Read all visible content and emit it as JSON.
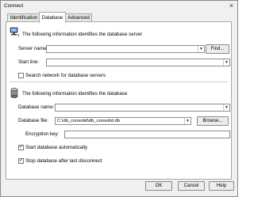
{
  "window": {
    "title": "Connect",
    "close_glyph": "×"
  },
  "tabs": [
    {
      "label": "Identification"
    },
    {
      "label": "Database"
    },
    {
      "label": "Advanced"
    }
  ],
  "server_section": {
    "heading": "The following information identifies the database server",
    "icon": "network-computer-icon",
    "server_name_label": "Server name:",
    "server_name_value": "",
    "find_button": "Find...",
    "start_line_label": "Start line:",
    "start_line_value": "",
    "search_network_label": "Search network for database servers",
    "search_network_checked": false
  },
  "database_section": {
    "heading": "The following information identifies the database",
    "icon": "database-cylinder-icon",
    "database_name_label": "Database name:",
    "database_name_value": "",
    "database_file_label": "Database file:",
    "database_file_value": "C:\\db_consolid\\db_consolid.db",
    "browse_button": "Browse...",
    "encryption_key_label": "Encryption key:",
    "encryption_key_value": "",
    "start_auto_label": "Start database automatically",
    "start_auto_checked": true,
    "stop_after_label": "Stop database after last disconnect",
    "stop_after_checked": true
  },
  "footer": {
    "ok": "OK",
    "cancel": "Cancel",
    "help": "Help"
  },
  "glyphs": {
    "check": "✓",
    "dropdown": "▼"
  }
}
